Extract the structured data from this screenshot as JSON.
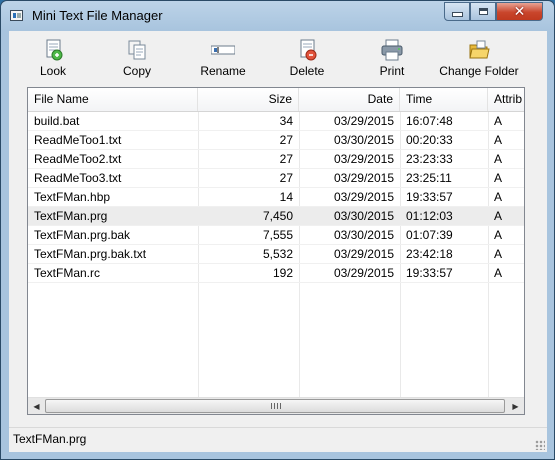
{
  "window": {
    "title": "Mini Text File Manager"
  },
  "toolbar": {
    "buttons": [
      {
        "label": "Look",
        "icon": "look-icon"
      },
      {
        "label": "Copy",
        "icon": "copy-icon"
      },
      {
        "label": "Rename",
        "icon": "rename-icon"
      },
      {
        "label": "Delete",
        "icon": "delete-icon"
      },
      {
        "label": "Print",
        "icon": "print-icon"
      },
      {
        "label": "Change Folder",
        "icon": "folder-icon"
      }
    ]
  },
  "list": {
    "columns": [
      "File Name",
      "Size",
      "Date",
      "Time",
      "Attrib"
    ],
    "rows": [
      {
        "name": "build.bat",
        "size": "34",
        "date": "03/29/2015",
        "time": "16:07:48",
        "attrib": "A"
      },
      {
        "name": "ReadMeToo1.txt",
        "size": "27",
        "date": "03/30/2015",
        "time": "00:20:33",
        "attrib": "A"
      },
      {
        "name": "ReadMeToo2.txt",
        "size": "27",
        "date": "03/29/2015",
        "time": "23:23:33",
        "attrib": "A"
      },
      {
        "name": "ReadMeToo3.txt",
        "size": "27",
        "date": "03/29/2015",
        "time": "23:25:11",
        "attrib": "A"
      },
      {
        "name": "TextFMan.hbp",
        "size": "14",
        "date": "03/29/2015",
        "time": "19:33:57",
        "attrib": "A"
      },
      {
        "name": "TextFMan.prg",
        "size": "7,450",
        "date": "03/30/2015",
        "time": "01:12:03",
        "attrib": "A"
      },
      {
        "name": "TextFMan.prg.bak",
        "size": "7,555",
        "date": "03/30/2015",
        "time": "01:07:39",
        "attrib": "A"
      },
      {
        "name": "TextFMan.prg.bak.txt",
        "size": "5,532",
        "date": "03/29/2015",
        "time": "23:42:18",
        "attrib": "A"
      },
      {
        "name": "TextFMan.rc",
        "size": "192",
        "date": "03/29/2015",
        "time": "19:33:57",
        "attrib": "A"
      }
    ],
    "selected_index": 5
  },
  "statusbar": {
    "text": "TextFMan.prg"
  }
}
